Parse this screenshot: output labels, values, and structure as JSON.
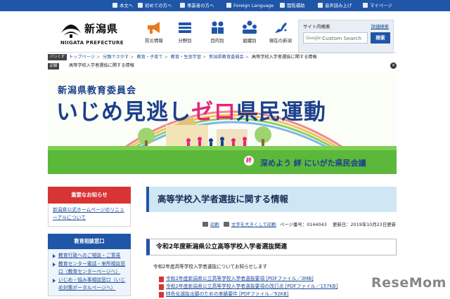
{
  "topbar": {
    "links": [
      "本文へ",
      "初めての方へ",
      "事業者の方へ",
      "Foreign Language",
      "閲覧補助",
      "音声読み上げ",
      "マイページ"
    ]
  },
  "header": {
    "logo_ja": "新潟県",
    "logo_en": "NIIGATA PREFECTURE",
    "nav": [
      "防災情報",
      "分野別",
      "目的別",
      "組織別",
      "現在の新潟"
    ],
    "search": {
      "title": "サイト内検索",
      "advanced": "詳細検索",
      "google": "Google",
      "placeholder": "Custom Search",
      "button": "検索"
    }
  },
  "breadcrumb": {
    "tag": "パンくず",
    "items": [
      "トップページ",
      "分類でさがす",
      "教育・子育て",
      "教育・生涯学習",
      "新潟県教育委員会"
    ],
    "current": "高等学校入学者選抜に関する情報"
  },
  "record": {
    "tag": "記録",
    "text": "高等学校入学者選抜に関する情報"
  },
  "banner": {
    "sub": "新潟県教育委員会",
    "main_before": "いじめ見逃し",
    "main_highlight": "ゼロ",
    "main_after": "県民運動",
    "footer_badge": "絆",
    "footer": "深めよう 絆 にいがた県民会議"
  },
  "sidebar": {
    "notice_header": "重要なお知らせ",
    "notice_link": "新潟県公式ホームページのリニューアルについて",
    "consult_header": "教育相談窓口",
    "consult_items": [
      "教育行政へのご相談・ご意見",
      "教育センター電話・来所相談窓口（教育センターページへ）",
      "いじめ・悩み事相談窓口（いじめ対策ポータルページへ）"
    ]
  },
  "main": {
    "title": "高等学校入学者選抜に関する情報",
    "print": "印刷",
    "font_size": "文字を大きくして印刷",
    "page_number": "ページ番号：0144043",
    "updated": "更新日：2019年10月23日更新",
    "section_title": "令和2年度新潟県公立高等学校入学者選抜関連",
    "lead": "令和2年度高等学校入学者選抜についてお知らせします",
    "files": [
      "令和2年度新潟県公立高等学校入学者選抜要項 [PDFファイル／3MB]",
      "令和2年度新潟県公立高等学校入学者選抜要項の改訂点 [PDFファイル／157KB]",
      "特色化選抜出願のための実績要件 [PDFファイル／92KB]"
    ]
  },
  "watermark": "ReseMom",
  "colors": {
    "primary": "#1f56a8",
    "alert": "#d83435",
    "title_bg": "#cfe6f4",
    "banner_text": "#1b3f8c",
    "banner_highlight": "#e5267c"
  }
}
